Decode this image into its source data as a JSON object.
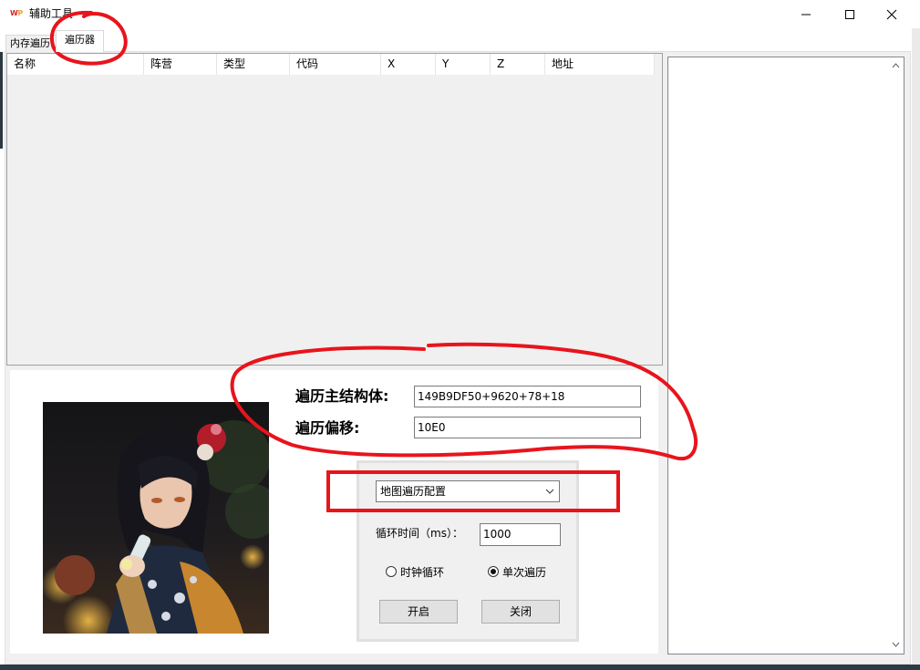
{
  "window": {
    "icon_text_w": "W",
    "icon_text_p": "P",
    "title": "辅助工具"
  },
  "tabs": [
    {
      "label": "内存遍历",
      "selected": false
    },
    {
      "label": "遍历器",
      "selected": true
    }
  ],
  "list": {
    "columns": [
      "名称",
      "阵营",
      "类型",
      "代码",
      "X",
      "Y",
      "Z",
      "地址"
    ]
  },
  "form": {
    "struct_label": "遍历主结构体:",
    "struct_value": "149B9DF50+9620+78+18",
    "offset_label": "遍历偏移:",
    "offset_value": "10E0",
    "config_selected": "地图遍历配置",
    "interval_label": "循环时间（ms）：",
    "interval_value": "1000",
    "radio_timer": "时钟循环",
    "radio_single": "单次遍历",
    "radio_selected": "single",
    "start_label": "开启",
    "close_label": "关闭"
  },
  "colors": {
    "annotation": "#e8141c",
    "accent_icon": "#d9242a"
  }
}
